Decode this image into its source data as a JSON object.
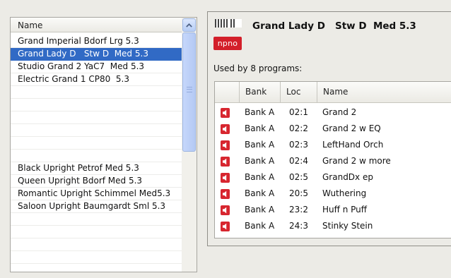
{
  "program_list": {
    "header": "Name",
    "items": [
      {
        "label": "Grand Imperial Bdorf Lrg 5.3",
        "selected": false
      },
      {
        "label": "Grand Lady D   Stw D  Med 5.3",
        "selected": true
      },
      {
        "label": "Studio Grand 2 YaC7  Med 5.3",
        "selected": false
      },
      {
        "label": "Electric Grand 1 CP80  5.3",
        "selected": false
      },
      {
        "label": "",
        "selected": false
      },
      {
        "label": "",
        "selected": false
      },
      {
        "label": "",
        "selected": false
      },
      {
        "label": "",
        "selected": false
      },
      {
        "label": "",
        "selected": false
      },
      {
        "label": "",
        "selected": false
      },
      {
        "label": "Black Upright Petrof Med 5.3",
        "selected": false
      },
      {
        "label": "Queen Upright Bdorf Med 5.3",
        "selected": false
      },
      {
        "label": "Romantic Upright Schimmel Med5.3",
        "selected": false
      },
      {
        "label": "Saloon Upright Baumgardt Sml 5.3",
        "selected": false
      },
      {
        "label": "",
        "selected": false
      },
      {
        "label": "",
        "selected": false
      },
      {
        "label": "",
        "selected": false
      },
      {
        "label": "",
        "selected": false
      },
      {
        "label": "",
        "selected": false
      }
    ]
  },
  "detail": {
    "badge": "npno",
    "title": "Grand Lady D   Stw D  Med 5.3",
    "used_by": "Used by 8 programs:",
    "columns": {
      "bank": "Bank",
      "loc": "Loc",
      "name": "Name"
    },
    "programs": [
      {
        "bank": "Bank A",
        "loc": "02:1",
        "name": "Grand 2"
      },
      {
        "bank": "Bank A",
        "loc": "02:2",
        "name": "Grand 2 w EQ"
      },
      {
        "bank": "Bank A",
        "loc": "02:3",
        "name": "LeftHand Orch"
      },
      {
        "bank": "Bank A",
        "loc": "02:4",
        "name": "Grand 2 w more"
      },
      {
        "bank": "Bank A",
        "loc": "02:5",
        "name": "GrandDx ep"
      },
      {
        "bank": "Bank A",
        "loc": "20:5",
        "name": "Wuthering"
      },
      {
        "bank": "Bank A",
        "loc": "23:2",
        "name": "Huff n Puff"
      },
      {
        "bank": "Bank A",
        "loc": "24:3",
        "name": "Stinky Stein"
      }
    ]
  },
  "icons": {
    "list_scroll_up": "chevron-up-icon",
    "piano": "piano-keys-icon",
    "program_row": "speaker-icon"
  },
  "colors": {
    "selection": "#316ac5",
    "badge": "#d31f2a",
    "program_icon": "#d7262f",
    "scroll_accent": "#b7cdf5"
  }
}
